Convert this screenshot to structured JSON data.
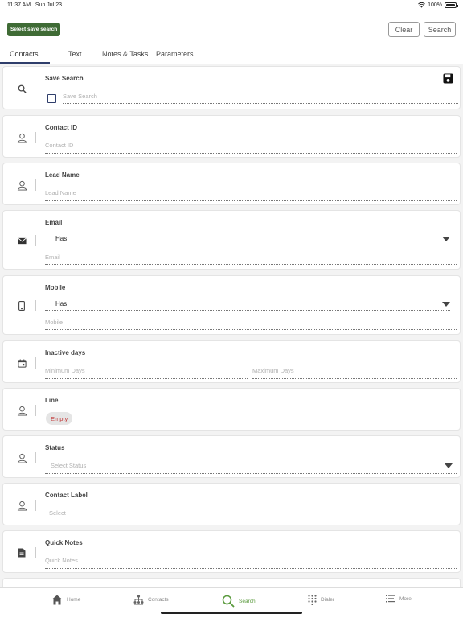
{
  "status_bar": {
    "time": "11:37 AM",
    "date": "Sun Jul 23",
    "battery": "100%"
  },
  "header": {
    "save_search_button": "Select save search",
    "clear_button": "Clear",
    "search_button": "Search",
    "tabs": [
      {
        "label": "Contacts",
        "active": true
      },
      {
        "label": "Text",
        "active": false
      },
      {
        "label": "Notes & Tasks",
        "active": false
      },
      {
        "label": "Parameters",
        "active": false
      }
    ]
  },
  "cards": {
    "save_search": {
      "title": "Save Search",
      "placeholder": "Save Search"
    },
    "contact_id": {
      "title": "Contact ID",
      "placeholder": "Contact ID"
    },
    "lead_name": {
      "title": "Lead Name",
      "placeholder": "Lead Name"
    },
    "email": {
      "title": "Email",
      "selected": "Has",
      "placeholder": "Email"
    },
    "mobile": {
      "title": "Mobile",
      "selected": "Has",
      "placeholder": "Mobile"
    },
    "inactive_days": {
      "title": "Inactive days",
      "min_placeholder": "Minimum Days",
      "max_placeholder": "Maximum Days"
    },
    "line": {
      "title": "Line",
      "chip": "Empty"
    },
    "status": {
      "title": "Status",
      "placeholder": "Select Status"
    },
    "contact_label": {
      "title": "Contact Label",
      "placeholder": "Select"
    },
    "quick_notes": {
      "title": "Quick Notes",
      "placeholder": "Quick Notes"
    }
  },
  "bottom_nav": [
    {
      "label": "Home",
      "icon": "home-icon",
      "active": false
    },
    {
      "label": "Contacts",
      "icon": "contacts-tree-icon",
      "active": false
    },
    {
      "label": "Search",
      "icon": "search-icon",
      "active": true
    },
    {
      "label": "Dialer",
      "icon": "dialpad-icon",
      "active": false
    },
    {
      "label": "More",
      "icon": "menu-icon",
      "active": false
    }
  ],
  "colors": {
    "brand_green": "#3f6b35",
    "nav_active": "#5a9a3d",
    "tab_underline": "#2f3e6b",
    "chip_text": "#c23a3a"
  }
}
